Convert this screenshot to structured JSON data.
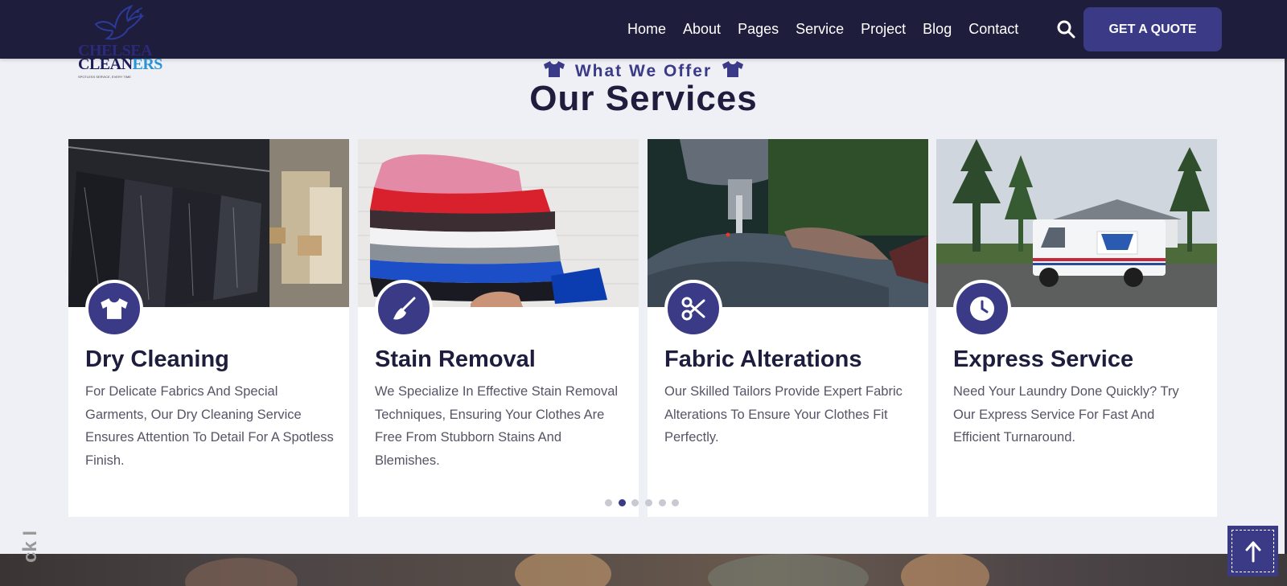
{
  "header": {
    "logo": {
      "line1": "CHELSEA",
      "line2_part1": "CLEAN",
      "line2_part2": "ERS",
      "tagline": "SPOTLESS SERVICE, EVERY TIME"
    },
    "nav": [
      "Home",
      "About",
      "Pages",
      "Service",
      "Project",
      "Blog",
      "Contact"
    ],
    "quote_button": "GET A QUOTE"
  },
  "section": {
    "subtitle": "What We Offer",
    "title": "Our Services"
  },
  "cards": [
    {
      "title": "Dry Cleaning",
      "text": "For Delicate Fabrics And Special Garments, Our Dry Cleaning Service Ensures Attention To Detail For A Spotless Finish.",
      "icon": "tshirt-icon"
    },
    {
      "title": "Stain Removal",
      "text": "We Specialize In Effective Stain Removal Techniques, Ensuring Your Clothes Are Free From Stubborn Stains And Blemishes.",
      "icon": "broom-icon"
    },
    {
      "title": "Fabric Alterations",
      "text": "Our Skilled Tailors Provide Expert Fabric Alterations To Ensure Your Clothes Fit Perfectly.",
      "icon": "scissors-icon"
    },
    {
      "title": "Express Service",
      "text": "Need Your Laundry Done Quickly? Try Our Express Service For Fast And Efficient Turnaround.",
      "icon": "clock-icon"
    }
  ],
  "pager": {
    "total": 6,
    "active_index": 1
  },
  "side_text": "ck I",
  "colors": {
    "primary": "#3a3a87",
    "header": "#1e1d3c",
    "background": "#eff0f5",
    "heading": "#1f1d3d"
  }
}
